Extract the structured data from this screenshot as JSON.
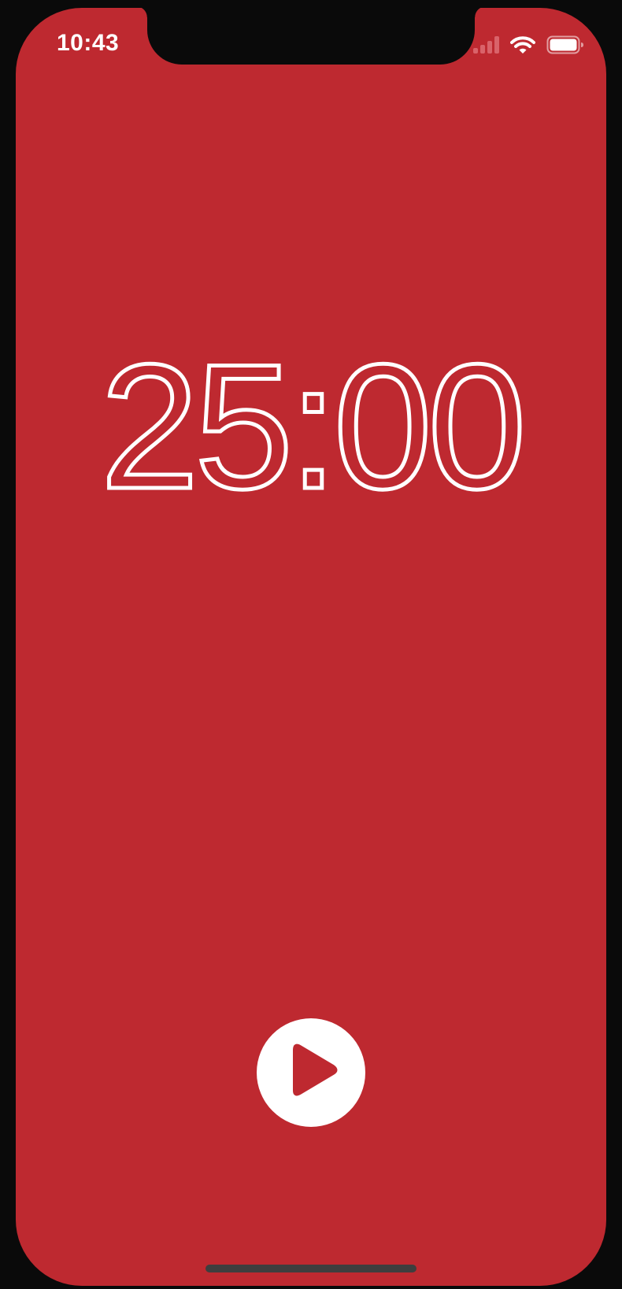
{
  "status_bar": {
    "time": "10:43",
    "signal_icon": "cellular-signal-icon",
    "wifi_icon": "wifi-icon",
    "battery_icon": "battery-icon"
  },
  "timer": {
    "minutes": "25",
    "separator": ":",
    "seconds": "00",
    "display": "25:00"
  },
  "controls": {
    "play_icon": "play-icon"
  },
  "colors": {
    "background": "#be2930",
    "foreground": "#ffffff",
    "bezel": "#0a0a0a"
  }
}
